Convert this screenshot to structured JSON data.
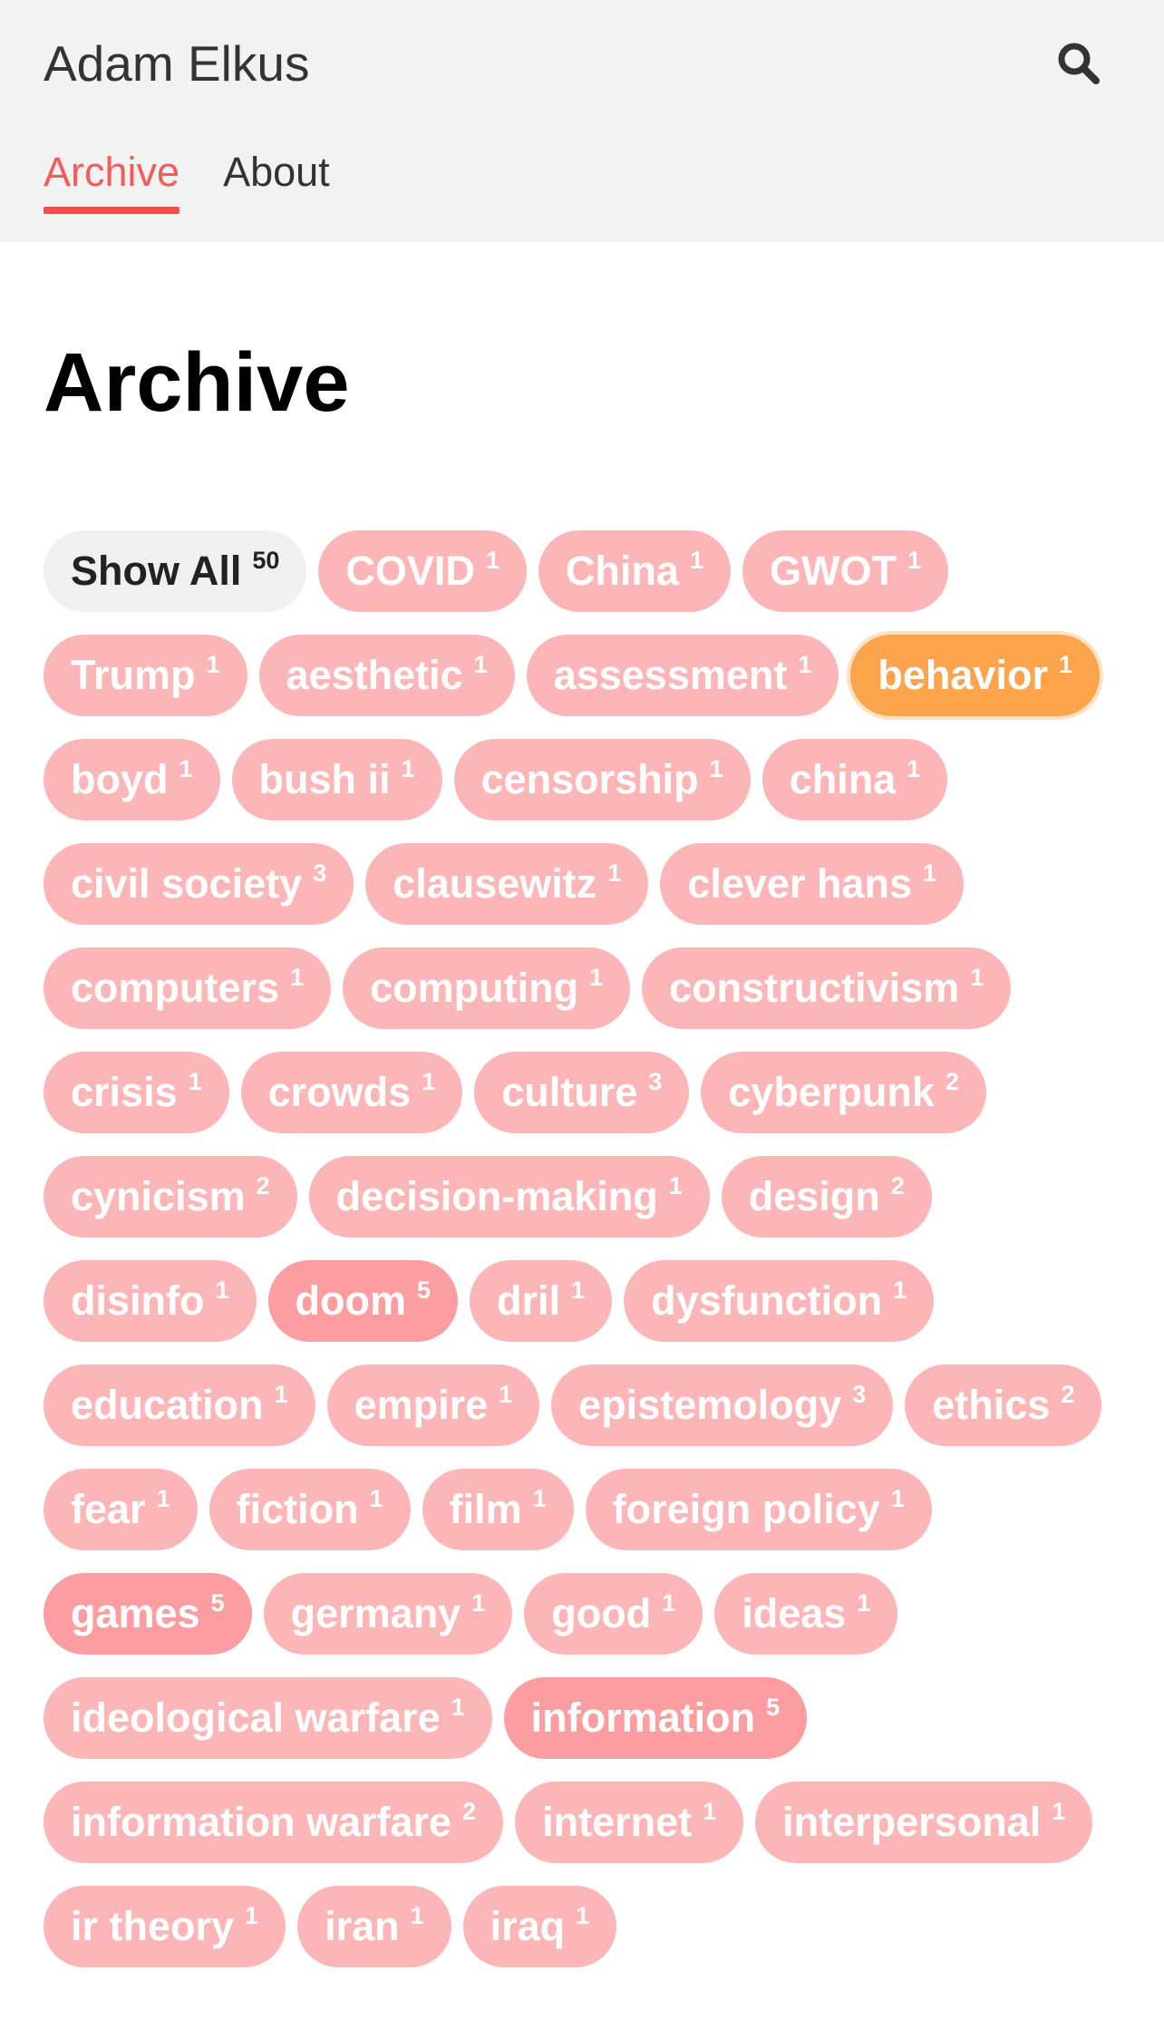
{
  "header": {
    "site_title": "Adam Elkus",
    "search_icon": "search-icon",
    "nav": [
      {
        "label": "Archive",
        "active": true
      },
      {
        "label": "About",
        "active": false
      }
    ]
  },
  "main": {
    "title": "Archive"
  },
  "colors": {
    "accent": "#f24d4d",
    "tag_default": "#fdb6b7",
    "tag_heavy": "#fc9ea1",
    "tag_selected": "#fca44c",
    "show_all_bg": "#f0f0f0"
  },
  "tags": [
    {
      "label": "Show All",
      "count": "50",
      "style": "show-all"
    },
    {
      "label": "COVID",
      "count": "1"
    },
    {
      "label": "China",
      "count": "1"
    },
    {
      "label": "GWOT",
      "count": "1"
    },
    {
      "label": "Trump",
      "count": "1"
    },
    {
      "label": "aesthetic",
      "count": "1"
    },
    {
      "label": "assessment",
      "count": "1"
    },
    {
      "label": "behavior",
      "count": "1",
      "style": "selected"
    },
    {
      "label": "boyd",
      "count": "1"
    },
    {
      "label": "bush ii",
      "count": "1"
    },
    {
      "label": "censorship",
      "count": "1"
    },
    {
      "label": "china",
      "count": "1"
    },
    {
      "label": "civil society",
      "count": "3"
    },
    {
      "label": "clausewitz",
      "count": "1"
    },
    {
      "label": "clever hans",
      "count": "1"
    },
    {
      "label": "computers",
      "count": "1"
    },
    {
      "label": "computing",
      "count": "1"
    },
    {
      "label": "constructivism",
      "count": "1"
    },
    {
      "label": "crisis",
      "count": "1"
    },
    {
      "label": "crowds",
      "count": "1"
    },
    {
      "label": "culture",
      "count": "3"
    },
    {
      "label": "cyberpunk",
      "count": "2"
    },
    {
      "label": "cynicism",
      "count": "2"
    },
    {
      "label": "decision-making",
      "count": "1"
    },
    {
      "label": "design",
      "count": "2"
    },
    {
      "label": "disinfo",
      "count": "1"
    },
    {
      "label": "doom",
      "count": "5",
      "style": "heavy"
    },
    {
      "label": "dril",
      "count": "1"
    },
    {
      "label": "dysfunction",
      "count": "1"
    },
    {
      "label": "education",
      "count": "1"
    },
    {
      "label": "empire",
      "count": "1"
    },
    {
      "label": "epistemology",
      "count": "3"
    },
    {
      "label": "ethics",
      "count": "2"
    },
    {
      "label": "fear",
      "count": "1"
    },
    {
      "label": "fiction",
      "count": "1"
    },
    {
      "label": "film",
      "count": "1"
    },
    {
      "label": "foreign policy",
      "count": "1"
    },
    {
      "label": "games",
      "count": "5",
      "style": "heavy"
    },
    {
      "label": "germany",
      "count": "1"
    },
    {
      "label": "good",
      "count": "1"
    },
    {
      "label": "ideas",
      "count": "1"
    },
    {
      "label": "ideological warfare",
      "count": "1"
    },
    {
      "label": "information",
      "count": "5",
      "style": "heavy"
    },
    {
      "label": "information warfare",
      "count": "2"
    },
    {
      "label": "internet",
      "count": "1"
    },
    {
      "label": "interpersonal",
      "count": "1"
    },
    {
      "label": "ir theory",
      "count": "1"
    },
    {
      "label": "iran",
      "count": "1"
    },
    {
      "label": "iraq",
      "count": "1"
    }
  ]
}
